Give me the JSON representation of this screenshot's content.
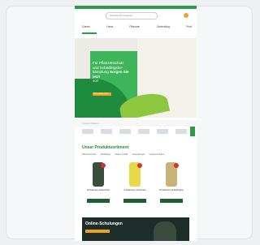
{
  "header": {
    "search_placeholder": "Suchbegriff eingeben"
  },
  "nav": {
    "items": [
      "Garten",
      "Haus",
      "Pflanzen",
      "Gartenblog",
      "Profi"
    ]
  },
  "hero": {
    "line1": "Für Pflanzenschutz",
    "line2": "und Schädlingsbe-",
    "line3": "kämpfung",
    "bold": "Sorgen Sie jetzt",
    "line4": "vor!",
    "cta": "Jetzt entdecken"
  },
  "trust": {
    "label": "Unsere Marken"
  },
  "section": {
    "title": "Unser Produktsortiment",
    "categories": [
      "Pflanzenschutz",
      "Schädlinge",
      "Rasen & Erde",
      "Gartendünger",
      "Unkraut & Moos"
    ]
  },
  "products": [
    {
      "name": "Produktname Gartenhelfer",
      "color": "#3b4f3f"
    },
    {
      "name": "Produktname Sprühmittel",
      "color": "#e7d94a"
    },
    {
      "name": "Produktname Schädlingsfrei",
      "color": "#c8b27a"
    }
  ],
  "promo": {
    "title": "Online-Schulungen"
  },
  "colors": {
    "accent": "#2e9a4a",
    "dark": "#1f8b3f",
    "orange": "#f2a31b"
  }
}
